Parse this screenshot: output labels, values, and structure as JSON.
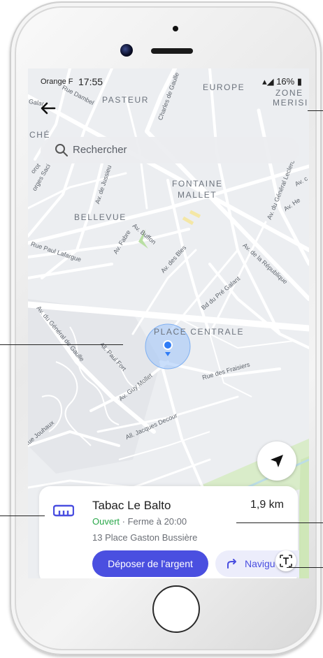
{
  "status_bar": {
    "carrier": "Orange F",
    "time": "17:55",
    "battery": "16%"
  },
  "search": {
    "placeholder": "Rechercher"
  },
  "map": {
    "districts": [
      "PASTEUR",
      "EUROPE",
      "ZONE",
      "MERISI",
      "FONTAINE",
      "MALLET",
      "BELLEVUE",
      "PLACE CENTRALE",
      "CHÉ"
    ],
    "streets": [
      "Rue Dambel",
      "Charles de Gaulle",
      "Av. de Jussieu",
      "Av. Fabre",
      "Av. Buffon",
      "Av. des Bles",
      "Rue Paul Lafargue",
      "Bd du Pré Galant",
      "Av. de la République",
      "Av. du Général Leclerc",
      "Av. du Général de Gaulle",
      "All. Paul Fort",
      "Av. Guy Mollet",
      "Rue des Fraisiers",
      "All. Jacques Decour",
      "Rue Jouhaux",
      "Av. He",
      "Av. c",
      "Galar",
      "orges Saci",
      "orot"
    ]
  },
  "colors": {
    "accent": "#4a4fe0",
    "open": "#2aa84a",
    "location": "#2f7cf6"
  },
  "place": {
    "icon": "atm-machine-icon",
    "name": "Tabac Le Balto",
    "distance": "1,9 km",
    "status_open": "Ouvert",
    "hours": " · Ferme à 20:00",
    "address": "13 Place Gaston Bussière",
    "deposit_button": "Déposer de l'argent",
    "navigate_button": "Navigu"
  }
}
